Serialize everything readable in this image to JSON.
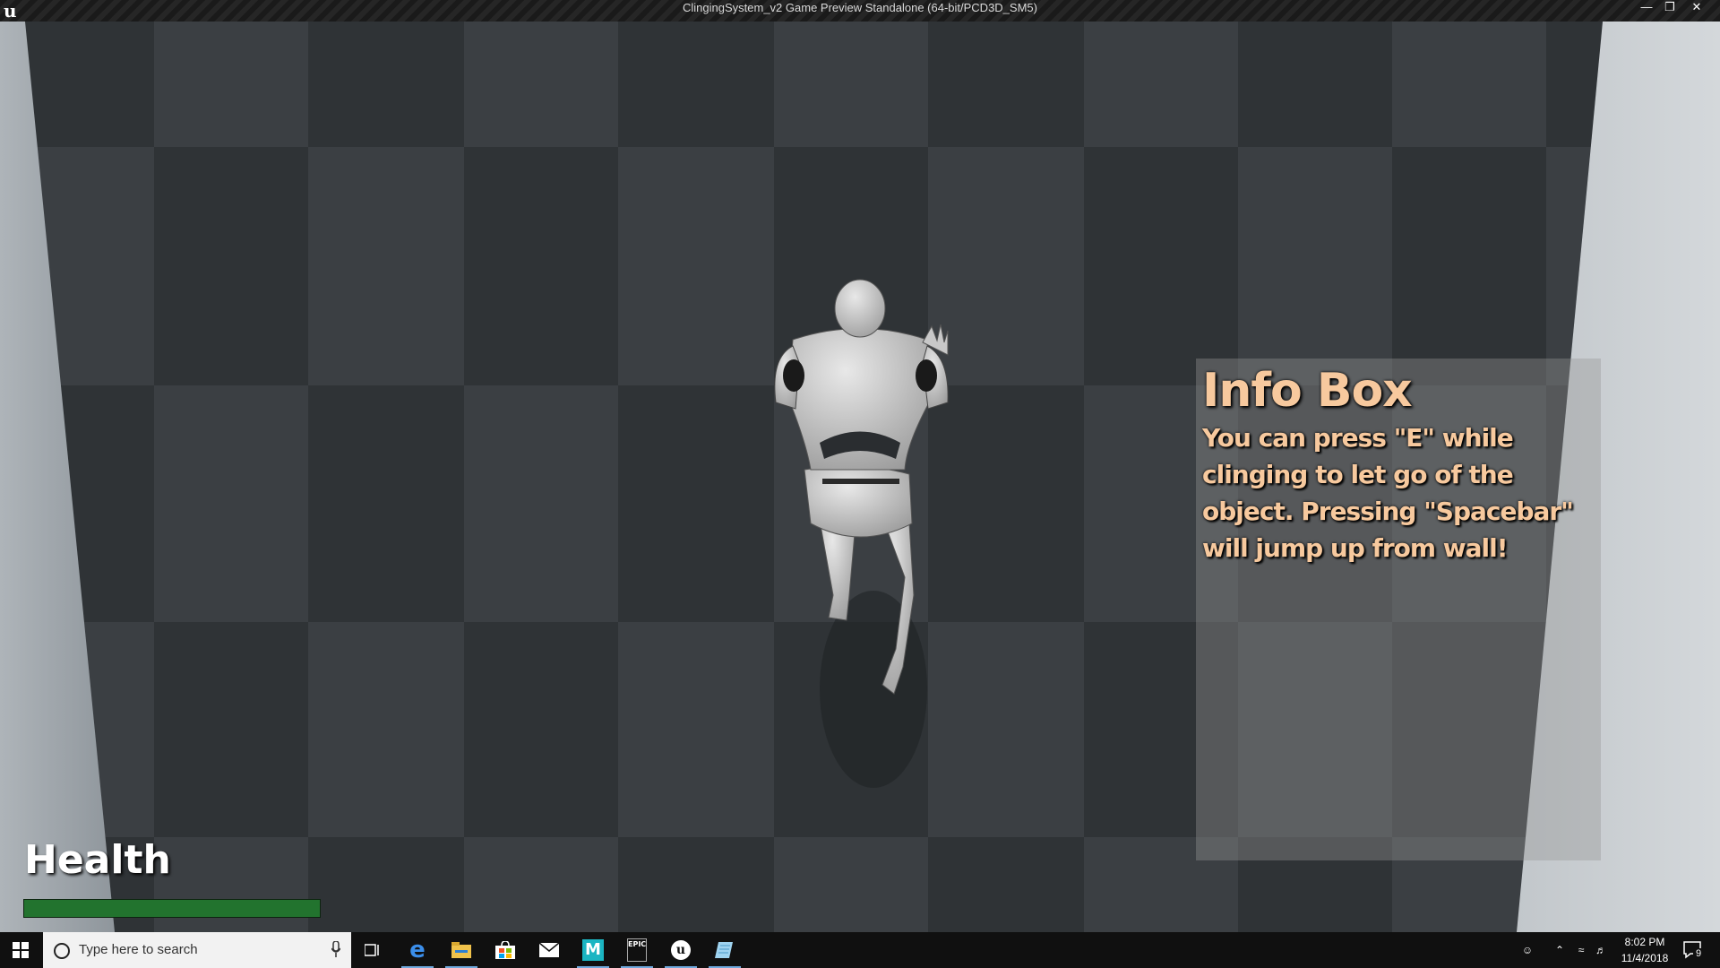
{
  "window": {
    "title": "ClingingSystem_v2 Game Preview Standalone (64-bit/PCD3D_SM5)",
    "logo_icon": "unreal-logo",
    "controls": [
      "minimize-icon",
      "restore-icon",
      "close-icon"
    ]
  },
  "hud": {
    "info_box": {
      "title": "Info Box",
      "body": "You can press \"E\" while clinging to let go of the object. Pressing \"Spacebar\" will jump up from wall!"
    },
    "health": {
      "label": "Health",
      "value": 1.0,
      "color": "#22732e"
    }
  },
  "taskbar": {
    "search_placeholder": "Type here to search",
    "apps": [
      "task-view-icon",
      "edge-icon",
      "file-explorer-icon",
      "store-icon",
      "mail-icon",
      "malwarebytes-icon",
      "epic-games-icon",
      "unreal-engine-icon",
      "notepad-icon"
    ],
    "clock": {
      "time": "8:02 PM",
      "date": "11/4/2018"
    },
    "notification_count": "9"
  }
}
